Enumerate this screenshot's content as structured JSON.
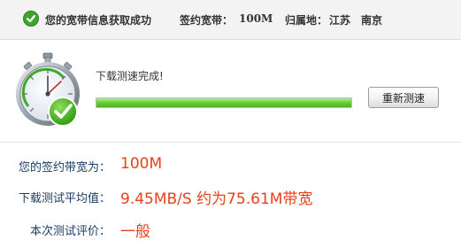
{
  "header": {
    "success_message": "您的宽带信息获取成功",
    "bandwidth_label": "签约宽带：",
    "bandwidth_value": "100M",
    "location_label": "归属地：",
    "location_province": "江苏",
    "location_city": "南京"
  },
  "speed_test": {
    "status": "下载测速完成!",
    "progress_percent": 100,
    "retest_label": "重新测速"
  },
  "results": {
    "contract_label": "您的签约带宽为：",
    "contract_value": "100M",
    "avg_label": "下载测试平均值：",
    "avg_value": "9.45MB/S 约为75.61M带宽",
    "rating_label": "本次测试评价：",
    "rating_value": "一般"
  },
  "icons": {
    "status": "check-circle-icon",
    "gauge": "stopwatch-check-icon"
  },
  "colors": {
    "accent_green": "#47b51b",
    "result_value": "#e8401b",
    "result_label": "#1a3f66"
  }
}
